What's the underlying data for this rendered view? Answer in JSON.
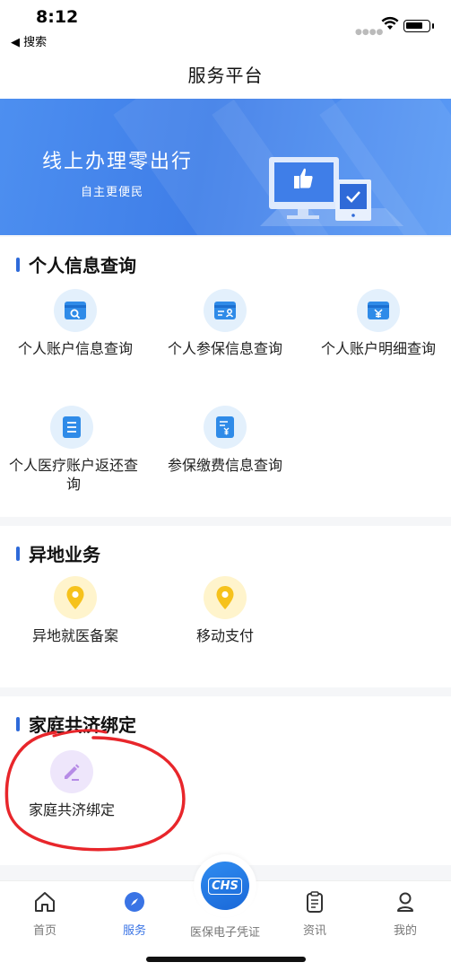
{
  "status": {
    "time": "8:12",
    "back_label": "◀ 搜索"
  },
  "nav": {
    "title": "服务平台"
  },
  "banner": {
    "title": "线上办理零出行",
    "subtitle": "自主更便民"
  },
  "sections": [
    {
      "title": "个人信息查询",
      "items": [
        {
          "label": "个人账户信息查询",
          "icon": "account-search-icon"
        },
        {
          "label": "个人参保信息查询",
          "icon": "insurance-card-icon"
        },
        {
          "label": "个人账户明细查询",
          "icon": "yuan-card-icon"
        },
        {
          "label": "个人医疗账户返还查询",
          "icon": "document-list-icon"
        },
        {
          "label": "参保缴费信息查询",
          "icon": "payment-doc-icon"
        }
      ]
    },
    {
      "title": "异地业务",
      "items": [
        {
          "label": "异地就医备案",
          "icon": "location-pin-icon"
        },
        {
          "label": "移动支付",
          "icon": "location-pin-icon"
        }
      ]
    },
    {
      "title": "家庭共济绑定",
      "items": [
        {
          "label": "家庭共济绑定",
          "icon": "edit-pencil-icon"
        }
      ]
    }
  ],
  "tabbar": {
    "items": [
      {
        "label": "首页",
        "icon": "home-icon"
      },
      {
        "label": "服务",
        "icon": "compass-icon",
        "active": true
      },
      {
        "label": "医保电子凭证",
        "icon": "chs-icon",
        "badge": "CHS"
      },
      {
        "label": "资讯",
        "icon": "clipboard-icon"
      },
      {
        "label": "我的",
        "icon": "user-icon"
      }
    ]
  },
  "colors": {
    "accent": "#3a74e5",
    "annotation": "#e8262b"
  }
}
